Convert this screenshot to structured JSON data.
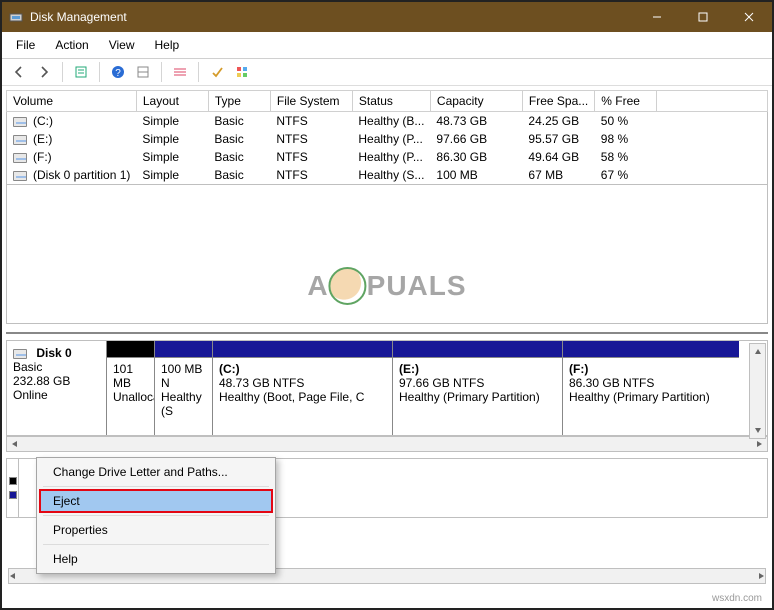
{
  "title": "Disk Management",
  "menu": {
    "file": "File",
    "action": "Action",
    "view": "View",
    "help": "Help"
  },
  "columns": {
    "volume": "Volume",
    "layout": "Layout",
    "type": "Type",
    "filesystem": "File System",
    "status": "Status",
    "capacity": "Capacity",
    "freespace": "Free Spa...",
    "pctfree": "% Free"
  },
  "rows": [
    {
      "volume": "(C:)",
      "layout": "Simple",
      "type": "Basic",
      "fs": "NTFS",
      "status": "Healthy (B...",
      "cap": "48.73 GB",
      "free": "24.25 GB",
      "pct": "50 %"
    },
    {
      "volume": "(E:)",
      "layout": "Simple",
      "type": "Basic",
      "fs": "NTFS",
      "status": "Healthy (P...",
      "cap": "97.66 GB",
      "free": "95.57 GB",
      "pct": "98 %"
    },
    {
      "volume": "(F:)",
      "layout": "Simple",
      "type": "Basic",
      "fs": "NTFS",
      "status": "Healthy (P...",
      "cap": "86.30 GB",
      "free": "49.64 GB",
      "pct": "58 %"
    },
    {
      "volume": "(Disk 0 partition 1)",
      "layout": "Simple",
      "type": "Basic",
      "fs": "NTFS",
      "status": "Healthy (S...",
      "cap": "100 MB",
      "free": "67 MB",
      "pct": "67 %"
    }
  ],
  "disk": {
    "name": "Disk 0",
    "kind": "Basic",
    "size": "232.88 GB",
    "state": "Online"
  },
  "parts": [
    {
      "name": "",
      "size": "101 MB",
      "status": "Unallocat",
      "dark": true
    },
    {
      "name": "",
      "size": "100 MB N",
      "status": "Healthy (S",
      "dark": false
    },
    {
      "name": "(C:)",
      "size": "48.73 GB NTFS",
      "status": "Healthy (Boot, Page File, C",
      "dark": false
    },
    {
      "name": "(E:)",
      "size": "97.66 GB NTFS",
      "status": "Healthy (Primary Partition)",
      "dark": false
    },
    {
      "name": "(F:)",
      "size": "86.30 GB NTFS",
      "status": "Healthy (Primary Partition)",
      "dark": false
    }
  ],
  "context": {
    "change": "Change Drive Letter and Paths...",
    "eject": "Eject",
    "properties": "Properties",
    "help": "Help"
  },
  "watermark": {
    "pre": "A",
    "post": "PUALS"
  },
  "footer": "wsxdn.com"
}
